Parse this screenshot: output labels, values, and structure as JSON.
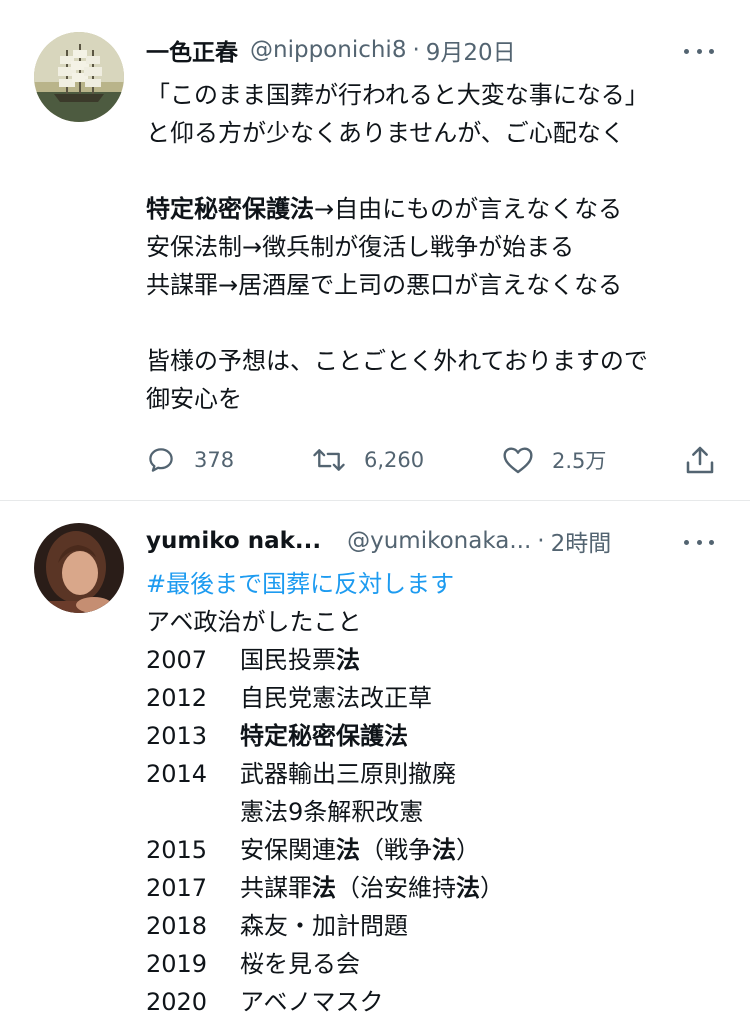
{
  "tweet1": {
    "name": "一色正春",
    "handle": "@nipponichi8",
    "sep": "·",
    "time": "9月20日",
    "lines": [
      [
        {
          "t": "「このまま国葬が行われると大変な事になる」"
        }
      ],
      [
        {
          "t": "と仰る方が少なくありませんが、ご心配なく"
        }
      ],
      [],
      [
        {
          "t": "特定秘密保護法",
          "b": true
        },
        {
          "t": "→自由にものが言えなくなる"
        }
      ],
      [
        {
          "t": "安保法制→徴兵制が復活し戦争が始まる"
        }
      ],
      [
        {
          "t": "共謀罪→居酒屋で上司の悪口が言えなくなる"
        }
      ],
      [],
      [
        {
          "t": "皆様の予想は、ことごとく外れておりますので"
        }
      ],
      [
        {
          "t": "御安心を"
        }
      ]
    ],
    "actions": {
      "replies": "378",
      "retweets": "6,260",
      "likes": "2.5万"
    }
  },
  "tweet2": {
    "name": "yumiko nak...",
    "handle": "@yumikonaka...",
    "sep": "·",
    "time": "2時間",
    "lines": [
      [
        {
          "t": "#最後まで国葬に反対します",
          "hashtag": true
        }
      ],
      [
        {
          "t": "アベ政治がしたこと"
        }
      ],
      [
        {
          "y": "2007"
        },
        {
          "t": "国民投票"
        },
        {
          "t": "法",
          "b": true
        }
      ],
      [
        {
          "y": "2012"
        },
        {
          "t": "自民党憲法改正草"
        }
      ],
      [
        {
          "y": "2013"
        },
        {
          "t": "特定秘密保護法",
          "b": true
        }
      ],
      [
        {
          "y": "2014"
        },
        {
          "t": "武器輸出三原則撤廃"
        }
      ],
      [
        {
          "y": ""
        },
        {
          "t": "憲法9条解釈改憲"
        }
      ],
      [
        {
          "y": "2015"
        },
        {
          "t": "安保関連"
        },
        {
          "t": "法",
          "b": true
        },
        {
          "t": "（戦争"
        },
        {
          "t": "法",
          "b": true
        },
        {
          "t": "）"
        }
      ],
      [
        {
          "y": "2017"
        },
        {
          "t": "共謀罪"
        },
        {
          "t": "法",
          "b": true
        },
        {
          "t": "（治安維持"
        },
        {
          "t": "法",
          "b": true
        },
        {
          "t": "）"
        }
      ],
      [
        {
          "y": "2018"
        },
        {
          "t": "森友・加計問題"
        }
      ],
      [
        {
          "y": "2019"
        },
        {
          "t": "桜を見る会"
        }
      ],
      [
        {
          "y": "2020"
        },
        {
          "t": "アベノマスク"
        }
      ]
    ]
  }
}
